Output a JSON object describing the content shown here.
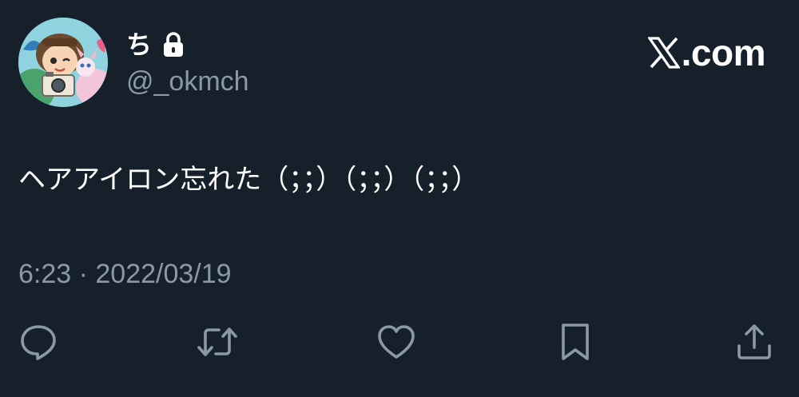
{
  "author": {
    "display_name": "ち",
    "handle": "@_okmch",
    "protected": true,
    "avatar_icon": "avatar-illustration"
  },
  "brand": {
    "icon": "x-logo-icon",
    "text": ".com"
  },
  "tweet": {
    "text": "ヘアアイロン忘れた（；；）（；；）（；；）",
    "timestamp": "6:23 · 2022/03/19"
  },
  "actions": [
    {
      "icon": "reply-icon"
    },
    {
      "icon": "retweet-icon"
    },
    {
      "icon": "like-icon"
    },
    {
      "icon": "bookmark-icon"
    },
    {
      "icon": "share-icon"
    }
  ],
  "colors": {
    "background": "#15202b",
    "text": "#ffffff",
    "secondary": "#8b98a5"
  }
}
